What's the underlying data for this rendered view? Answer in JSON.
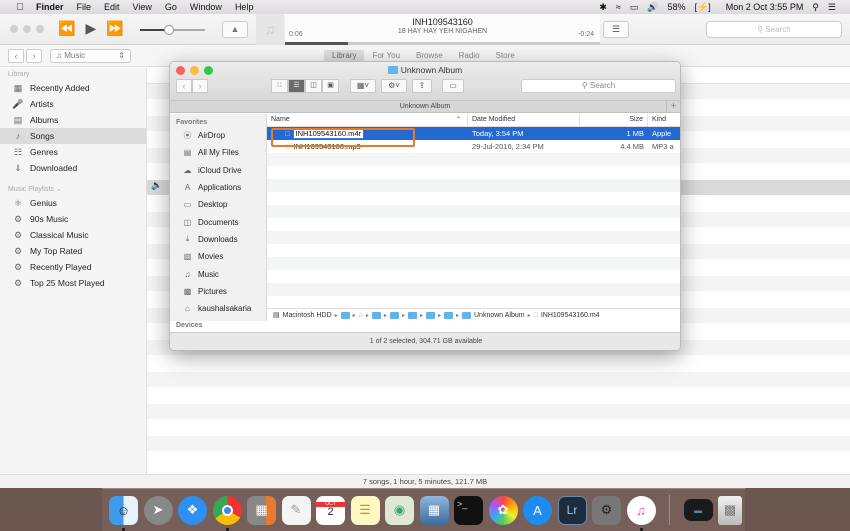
{
  "menubar": {
    "app_name": "Finder",
    "items": [
      "File",
      "Edit",
      "View",
      "Go",
      "Window",
      "Help"
    ],
    "battery": "58%",
    "datetime": "Mon 2 Oct  3:55 PM"
  },
  "itunes": {
    "now_playing": {
      "title": "INH109543160",
      "subtitle": "18 HAY HAY YEH NIGAHEN",
      "elapsed": "0:06",
      "remaining": "-0:24",
      "progress_fraction": 0.2,
      "volume_fraction": 0.45
    },
    "search_placeholder": "Search",
    "media_selector": "Music",
    "tabs": [
      {
        "label": "Library",
        "active": true
      },
      {
        "label": "For You",
        "active": false
      },
      {
        "label": "Browse",
        "active": false
      },
      {
        "label": "Radio",
        "active": false
      },
      {
        "label": "Store",
        "active": false
      }
    ],
    "sidebar": {
      "library_heading": "Library",
      "library_items": [
        {
          "label": "Recently Added",
          "icon": "grid-icon",
          "selected": false
        },
        {
          "label": "Artists",
          "icon": "microphone-icon",
          "selected": false
        },
        {
          "label": "Albums",
          "icon": "album-icon",
          "selected": false
        },
        {
          "label": "Songs",
          "icon": "music-note-icon",
          "selected": true
        },
        {
          "label": "Genres",
          "icon": "genres-icon",
          "selected": false
        },
        {
          "label": "Downloaded",
          "icon": "download-icon",
          "selected": false
        }
      ],
      "playlists_heading": "Music Playlists ⌄",
      "playlists": [
        {
          "label": "Genius",
          "icon": "genius-icon"
        },
        {
          "label": "90s Music",
          "icon": "gear-icon"
        },
        {
          "label": "Classical Music",
          "icon": "gear-icon"
        },
        {
          "label": "My Top Rated",
          "icon": "gear-icon"
        },
        {
          "label": "Recently Played",
          "icon": "gear-icon"
        },
        {
          "label": "Top 25 Most Played",
          "icon": "gear-icon"
        }
      ]
    },
    "status": "7 songs, 1 hour, 5 minutes, 121.7 MB"
  },
  "finder": {
    "window_title": "Unknown Album",
    "path_title": "Unknown Album",
    "search_placeholder": "Search",
    "sidebar": {
      "favorites_heading": "Favorites",
      "favorites": [
        {
          "label": "AirDrop",
          "icon": "airdrop-icon"
        },
        {
          "label": "All My Files",
          "icon": "all-files-icon"
        },
        {
          "label": "iCloud Drive",
          "icon": "cloud-icon"
        },
        {
          "label": "Applications",
          "icon": "applications-icon"
        },
        {
          "label": "Desktop",
          "icon": "desktop-icon"
        },
        {
          "label": "Documents",
          "icon": "documents-icon"
        },
        {
          "label": "Downloads",
          "icon": "downloads-icon"
        },
        {
          "label": "Movies",
          "icon": "movies-icon"
        },
        {
          "label": "Music",
          "icon": "music-icon"
        },
        {
          "label": "Pictures",
          "icon": "pictures-icon"
        },
        {
          "label": "kaushalsakaria",
          "icon": "home-icon"
        }
      ],
      "devices_heading": "Devices"
    },
    "columns": [
      "Name",
      "Date Modified",
      "Size",
      "Kind"
    ],
    "files": [
      {
        "name": "INH109543160.m4r",
        "date": "Today, 3:54 PM",
        "size": "1 MB",
        "kind": "Apple",
        "selected": true,
        "editing": true
      },
      {
        "name": "INH109543160.mp3",
        "date": "29-Jul-2016, 2:34 PM",
        "size": "4.4 MB",
        "kind": "MP3 a",
        "selected": false,
        "editing": false
      }
    ],
    "breadcrumbs": {
      "root": "Macintosh HDD",
      "album": "Unknown Album",
      "file": "INH109543160.m4"
    },
    "status": "1 of 2 selected, 304.71 GB available"
  },
  "dock": {
    "calendar_month": "OCT",
    "calendar_day": "2",
    "lightroom_label": "Lr",
    "apps": [
      "Finder",
      "Launchpad",
      "Safari",
      "Chrome",
      "Calculator",
      "TextEdit",
      "Calendar",
      "Notes",
      "Preview-Maps",
      "Preview",
      "Terminal",
      "Photos",
      "App Store",
      "Lightroom",
      "System Preferences",
      "iTunes",
      "Scanner",
      "Trash"
    ]
  }
}
